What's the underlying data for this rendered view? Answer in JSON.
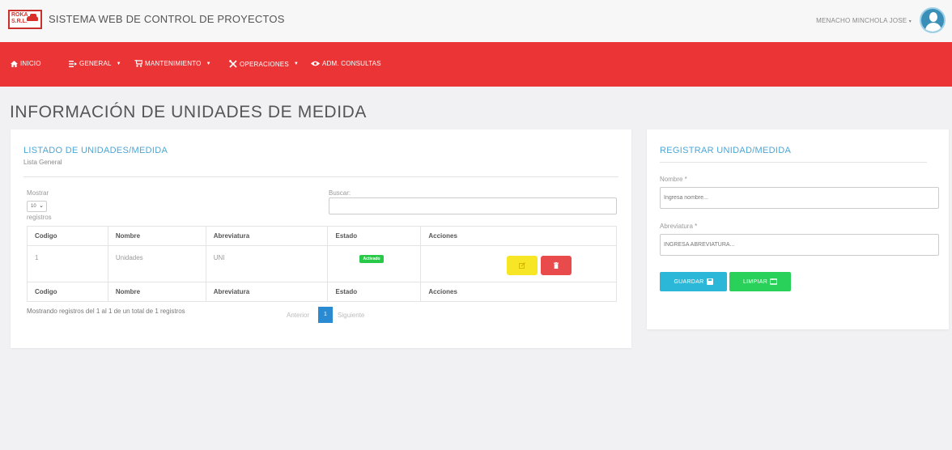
{
  "header": {
    "logo_text": "ROKA S.R.L.",
    "app_title": "SISTEMA WEB DE CONTROL DE PROYECTOS",
    "user_name": "MENACHO MINCHOLA JOSE"
  },
  "nav": {
    "items": [
      {
        "label": "INICIO",
        "icon": "home-icon"
      },
      {
        "label": "GENERAL",
        "icon": "list-icon"
      },
      {
        "label": "MANTENIMIENTO",
        "icon": "cart-icon"
      },
      {
        "label": "OPERACIONES",
        "icon": "tools-icon"
      },
      {
        "label": "ADM. CONSULTAS",
        "icon": "eye-icon"
      }
    ]
  },
  "page": {
    "title": "INFORMACIÓN DE UNIDADES DE MEDIDA"
  },
  "list_panel": {
    "title": "LISTADO DE UNIDADES/MEDIDA",
    "subtitle": "Lista General",
    "show_label": "Mostrar",
    "page_size": "10",
    "records_label": "registros",
    "search_label": "Buscar:",
    "search_value": "",
    "columns": [
      "Codigo",
      "Nombre",
      "Abreviatura",
      "Estado",
      "Acciones"
    ],
    "rows": [
      {
        "codigo": "1",
        "nombre": "Unidades",
        "abreviatura": "UNI",
        "estado": "Activado"
      }
    ],
    "info": "Mostrando registros del 1 al 1 de un total de 1 registros",
    "pager": {
      "previous": "Anterior",
      "current": "1",
      "next": "Siguiente"
    }
  },
  "form_panel": {
    "title": "REGISTRAR UNIDAD/MEDIDA",
    "name_label": "Nombre *",
    "name_placeholder": "Ingresa nombre...",
    "abbr_label": "Abreviatura *",
    "abbr_placeholder": "INGRESA ABREVIATURA...",
    "save_label": "GUARDAR",
    "clear_label": "LIMPIAR"
  },
  "colors": {
    "nav_red": "#ea3435",
    "accent_blue": "#4da6d6",
    "badge_green": "#28c848",
    "edit_yellow": "#f6e625",
    "delete_red": "#e94b4c",
    "save_cyan": "#2bb7d8",
    "clear_green": "#29d05a"
  }
}
